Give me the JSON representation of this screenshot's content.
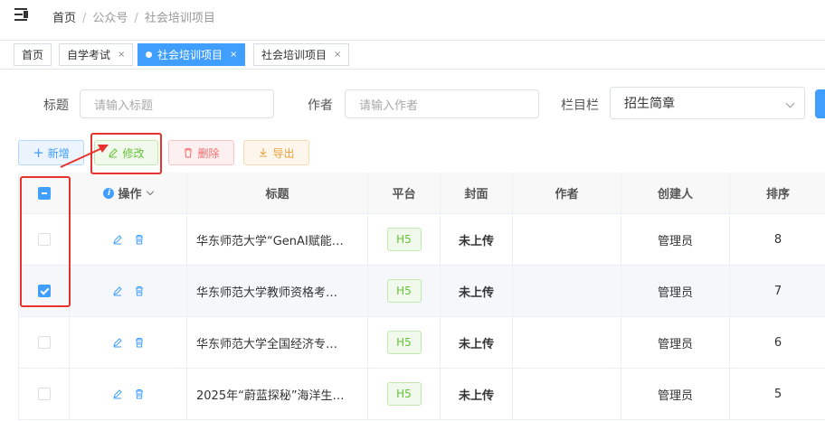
{
  "breadcrumb": {
    "home": "首页",
    "level2": "公众号",
    "current": "社会培训项目",
    "separator": "/"
  },
  "tabs": [
    {
      "label": "首页",
      "closable": false,
      "active": false
    },
    {
      "label": "自学考试",
      "closable": true,
      "active": false
    },
    {
      "label": "社会培训项目",
      "closable": true,
      "active": true
    },
    {
      "label": "社会培训项目",
      "closable": true,
      "active": false
    }
  ],
  "tab_close": "×",
  "search": {
    "title_label": "标题",
    "title_placeholder": "请输入标题",
    "author_label": "作者",
    "author_placeholder": "请输入作者",
    "column_label": "栏目栏",
    "column_value": "招生简章"
  },
  "toolbar": {
    "add": "新增",
    "edit": "修改",
    "delete": "删除",
    "export": "导出"
  },
  "table": {
    "headers": {
      "actions": "操作",
      "title": "标题",
      "platform": "平台",
      "cover": "封面",
      "author": "作者",
      "creator": "创建人",
      "sort": "排序"
    },
    "rows": [
      {
        "title": "华东师范大学“GenAI赋能…",
        "platform": "H5",
        "cover": "未上传",
        "author": "",
        "creator": "管理员",
        "sort": "8",
        "checked": false
      },
      {
        "title": "华东师范大学教师资格考…",
        "platform": "H5",
        "cover": "未上传",
        "author": "",
        "creator": "管理员",
        "sort": "7",
        "checked": true
      },
      {
        "title": "华东师范大学全国经济专…",
        "platform": "H5",
        "cover": "未上传",
        "author": "",
        "creator": "管理员",
        "sort": "6",
        "checked": false
      },
      {
        "title": "2025年“蔚蓝探秘”海洋生…",
        "platform": "H5",
        "cover": "未上传",
        "author": "",
        "creator": "管理员",
        "sort": "5",
        "checked": false
      }
    ]
  },
  "colors": {
    "primary": "#409eff",
    "success": "#67c23a",
    "danger": "#f56c6c",
    "warning": "#e6a23c",
    "annotation": "#e8322d"
  }
}
